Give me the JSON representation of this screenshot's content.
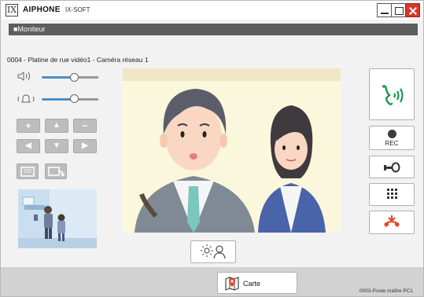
{
  "titlebar": {
    "logo_glyph": "IX",
    "brand": "AIPHONE",
    "product": "IX-SOFT"
  },
  "section": {
    "title": "■Moniteur"
  },
  "station": {
    "label": "0004 - Platine de rue vidéo1 - Caméra réseau 1"
  },
  "volume": {
    "speaker_level_pct": 55,
    "ringtone_level_pct": 55
  },
  "ptz": {
    "zoom_in": "+",
    "up": "▲",
    "zoom_out": "−",
    "left": "◀",
    "down": "▼",
    "right": "▶"
  },
  "right_panel": {
    "rec_label": "REC"
  },
  "bottom": {
    "map_label": "Carte",
    "footer_station": "0003-Poste maître PC1"
  },
  "colors": {
    "accent_green": "#1a9b4b",
    "hangup_orange": "#e5452a",
    "section_gray": "#5e5e5e"
  }
}
